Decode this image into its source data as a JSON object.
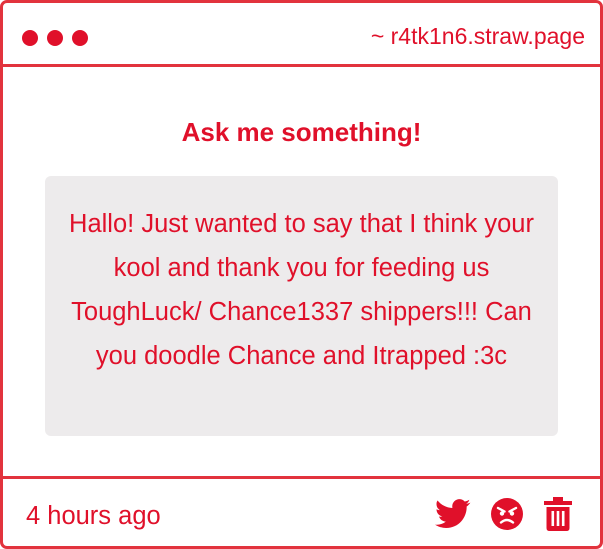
{
  "window": {
    "dots": [
      "dot",
      "dot",
      "dot"
    ],
    "site": "~ r4tk1n6.straw.page"
  },
  "prompt": {
    "heading": "Ask me something!"
  },
  "question": {
    "text": "Hallo! Just wanted to say that I think your kool and thank you for feeding us ToughLuck/ Chance1337 shippers!!! Can you doodle Chance and Itrapped :3c"
  },
  "footer": {
    "timestamp": "4 hours ago",
    "actions": [
      "twitter-icon",
      "angry-face-icon",
      "trash-icon"
    ]
  },
  "colors": {
    "accent": "#e0102a",
    "border": "#e2333d",
    "bubble": "#edebec",
    "background": "#ffffff"
  }
}
